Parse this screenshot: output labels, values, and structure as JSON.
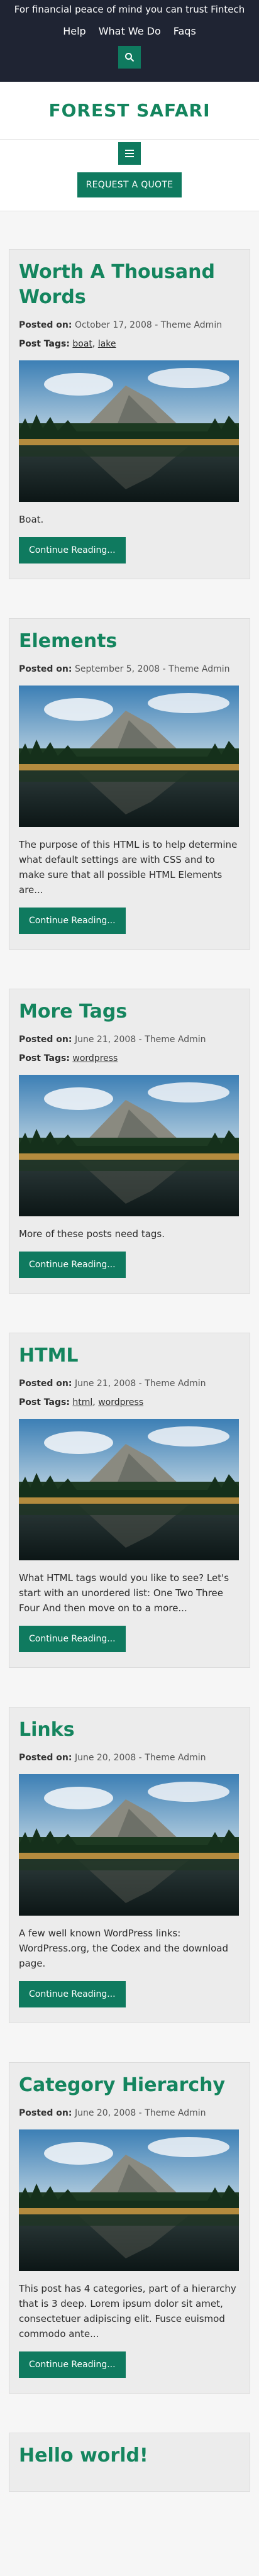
{
  "topbar": {
    "tagline": "For financial peace of mind you can trust Fintech",
    "nav": [
      "Help",
      "What We Do",
      "Faqs"
    ]
  },
  "brand": {
    "logo": "FOREST SAFARI"
  },
  "nav": {
    "quote_label": "REQUEST A QUOTE"
  },
  "labels": {
    "posted_on": "Posted on:",
    "post_tags": "Post Tags:",
    "read_more": "Continue Reading..."
  },
  "posts": [
    {
      "title": "Worth A Thousand Words",
      "date": "October 17, 2008",
      "author": "Theme Admin",
      "tags": [
        "boat",
        "lake"
      ],
      "excerpt": "Boat."
    },
    {
      "title": "Elements",
      "date": "September 5, 2008",
      "author": "Theme Admin",
      "tags": [],
      "excerpt": "The purpose of this HTML is to help determine what default settings are with CSS and to make sure that all possible HTML Elements are..."
    },
    {
      "title": "More Tags",
      "date": "June 21, 2008",
      "author": "Theme Admin",
      "tags": [
        "wordpress"
      ],
      "excerpt": "More of these posts need tags."
    },
    {
      "title": "HTML",
      "date": "June 21, 2008",
      "author": "Theme Admin",
      "tags": [
        "html",
        "wordpress"
      ],
      "excerpt": "What HTML tags would you like to see? Let's start with an unordered list: One Two Three Four And then move on to a more..."
    },
    {
      "title": "Links",
      "date": "June 20, 2008",
      "author": "Theme Admin",
      "tags": [],
      "excerpt": "A few well known WordPress links: WordPress.org, the Codex and the download page."
    },
    {
      "title": "Category Hierarchy",
      "date": "June 20, 2008",
      "author": "Theme Admin",
      "tags": [],
      "excerpt": "This post has 4 categories, part of a hierarchy that is 3 deep. Lorem ipsum dolor sit amet, consectetuer adipiscing elit. Fusce euismod commodo ante..."
    },
    {
      "title": "Hello world!",
      "date": "",
      "author": "",
      "tags": [],
      "excerpt": ""
    }
  ],
  "colors": {
    "accent": "#0f7a5f",
    "title": "#14855e",
    "topbar": "#1f2433"
  }
}
